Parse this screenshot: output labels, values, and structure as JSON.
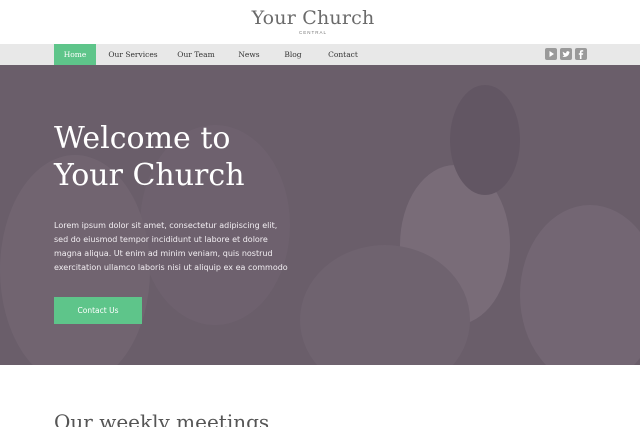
{
  "header": {
    "title": "Your Church",
    "subtitle": "CENTRAL"
  },
  "nav": {
    "items": [
      {
        "label": "Home"
      },
      {
        "label": "Our Services"
      },
      {
        "label": "Our Team"
      },
      {
        "label": "News"
      },
      {
        "label": "Blog"
      },
      {
        "label": "Contact"
      }
    ],
    "active_index": 0,
    "social": [
      "youtube-icon",
      "twitter-icon",
      "facebook-icon"
    ]
  },
  "hero": {
    "title_line1": "Welcome to",
    "title_line2": "Your Church",
    "text_lines": [
      "Lorem ipsum dolor sit amet, consectetur adipiscing elit,",
      "sed do eiusmod tempor incididunt ut labore et dolore",
      "magna aliqua. Ut enim ad minim veniam, quis nostrud",
      "exercitation ullamco laboris nisi ut aliquip ex ea commodo"
    ],
    "button_label": "Contact Us"
  },
  "section": {
    "title": "Our weekly meetings"
  },
  "colors": {
    "accent": "#5ec58a",
    "hero_overlay": "#6a5f6b",
    "nav_bg": "#e8e8e8"
  }
}
